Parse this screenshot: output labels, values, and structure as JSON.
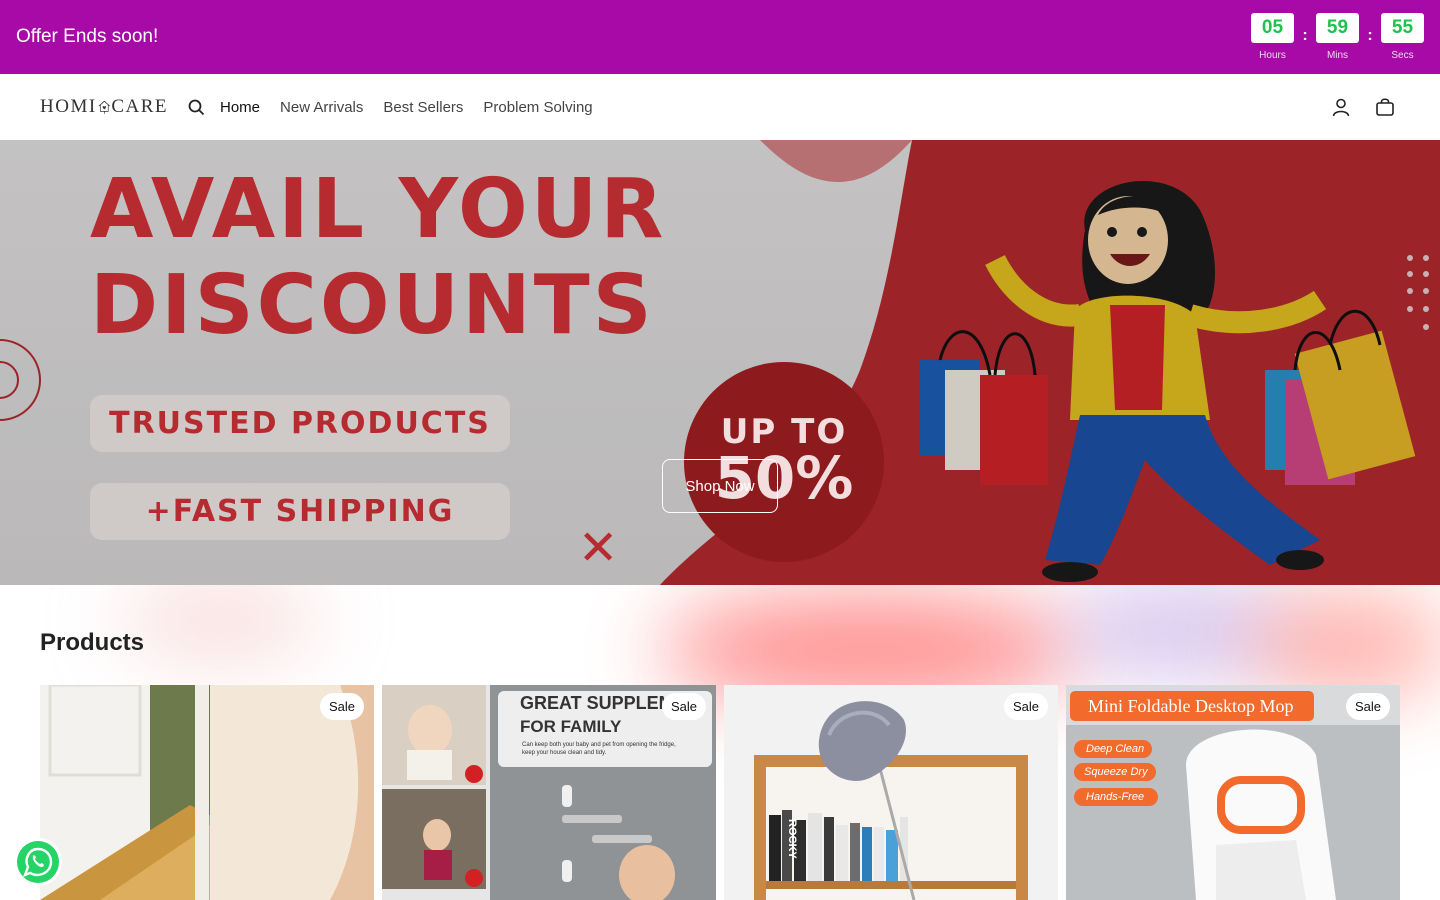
{
  "announcement": {
    "text": "Offer Ends soon!",
    "timer": {
      "hours": "05",
      "hours_label": "Hours",
      "mins": "59",
      "mins_label": "Mins",
      "secs": "55",
      "secs_label": "Secs",
      "separator": ":"
    }
  },
  "header": {
    "logo_left": "HOMI",
    "logo_right": "CARE",
    "nav": [
      "Home",
      "New Arrivals",
      "Best Sellers",
      "Problem Solving"
    ],
    "icons": [
      "search-icon",
      "account-icon",
      "cart-icon"
    ]
  },
  "hero": {
    "headline_line1": "AVAIL YOUR",
    "headline_line2": "DISCOUNTS",
    "pill1": "TRUSTED PRODUCTS",
    "pill2": "+FAST SHIPPING",
    "badge_top": "UP TO",
    "badge_value": "50%",
    "cta": "Shop Now"
  },
  "products": {
    "title": "Products",
    "cards": [
      {
        "badge": "Sale"
      },
      {
        "badge": "Sale",
        "image_text_1": "GREAT SUPPLEME",
        "image_text_2": "FOR FAMILY",
        "image_text_3": "Can keep both your baby and pet from opening the fridge,",
        "image_text_4": "keep your house clean and tidy."
      },
      {
        "badge": "Sale",
        "book_label": "ROCKY"
      },
      {
        "badge": "Sale",
        "image_title": "Mini Foldable Desktop Mop",
        "feature_1": "Deep Clean",
        "feature_2": "Squeeze Dry",
        "feature_3": "Hands-Free"
      }
    ]
  },
  "colors": {
    "topbar": "#a70aa7",
    "timer_digits": "#1ec24c",
    "hero_red": "#b62b2f",
    "whatsapp": "#25d366"
  }
}
